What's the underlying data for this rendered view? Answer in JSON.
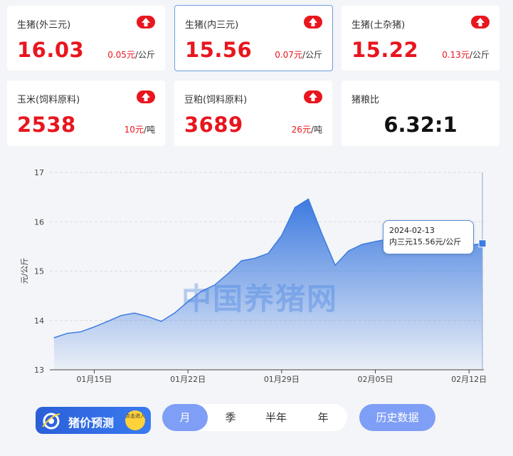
{
  "cards": [
    {
      "label": "生猪(外三元)",
      "value": "16.03",
      "change_value": "0.05元",
      "change_unit": "/公斤",
      "trend": "up"
    },
    {
      "label": "生猪(内三元)",
      "value": "15.56",
      "change_value": "0.07元",
      "change_unit": "/公斤",
      "trend": "up",
      "selected": true
    },
    {
      "label": "生猪(土杂猪)",
      "value": "15.22",
      "change_value": "0.13元",
      "change_unit": "/公斤",
      "trend": "up"
    },
    {
      "label": "玉米(饲料原料)",
      "value": "2538",
      "change_value": "10元",
      "change_unit": "/吨",
      "trend": "up"
    },
    {
      "label": "豆粕(饲料原料)",
      "value": "3689",
      "change_value": "26元",
      "change_unit": "/吨",
      "trend": "up"
    },
    {
      "label": "猪粮比",
      "value": "6.32:1"
    }
  ],
  "chart_data": {
    "type": "area",
    "ylabel": "元/公斤",
    "ylim": [
      13,
      17
    ],
    "yticks": [
      "13",
      "14",
      "15",
      "16",
      "17"
    ],
    "xticks": [
      "01月15日",
      "01月22日",
      "01月29日",
      "02月05日",
      "02月12日"
    ],
    "grid": true,
    "series": [
      {
        "x": [
          "2024-01-12",
          "2024-01-13",
          "2024-01-14",
          "2024-01-15",
          "2024-01-16",
          "2024-01-17",
          "2024-01-18",
          "2024-01-19",
          "2024-01-20",
          "2024-01-21",
          "2024-01-22",
          "2024-01-23",
          "2024-01-24",
          "2024-01-25",
          "2024-01-26",
          "2024-01-27",
          "2024-01-28",
          "2024-01-29",
          "2024-01-30",
          "2024-01-31",
          "2024-02-01",
          "2024-02-02",
          "2024-02-03",
          "2024-02-04",
          "2024-02-05",
          "2024-02-06",
          "2024-02-07",
          "2024-02-08",
          "2024-02-09",
          "2024-02-10",
          "2024-02-11",
          "2024-02-12",
          "2024-02-13"
        ],
        "values": [
          13.65,
          13.74,
          13.77,
          13.87,
          13.98,
          14.1,
          14.15,
          14.08,
          13.98,
          14.15,
          14.38,
          14.59,
          14.72,
          14.95,
          15.21,
          15.26,
          15.36,
          15.72,
          16.29,
          16.46,
          15.76,
          15.12,
          15.41,
          15.54,
          15.6,
          15.65,
          15.66,
          15.62,
          15.58,
          15.55,
          15.53,
          15.52,
          15.56
        ]
      }
    ],
    "tooltip": {
      "date": "2024-02-13",
      "text": "内三元15.56元/公斤"
    },
    "watermark": "中国养猪网",
    "fill_color": "#3d7be0"
  },
  "controls": {
    "forecast_label": "猪价预测",
    "forecast_badge": "点击进入",
    "periods": [
      "月",
      "季",
      "半年",
      "年"
    ],
    "active_period": "月",
    "history_label": "历史数据"
  }
}
